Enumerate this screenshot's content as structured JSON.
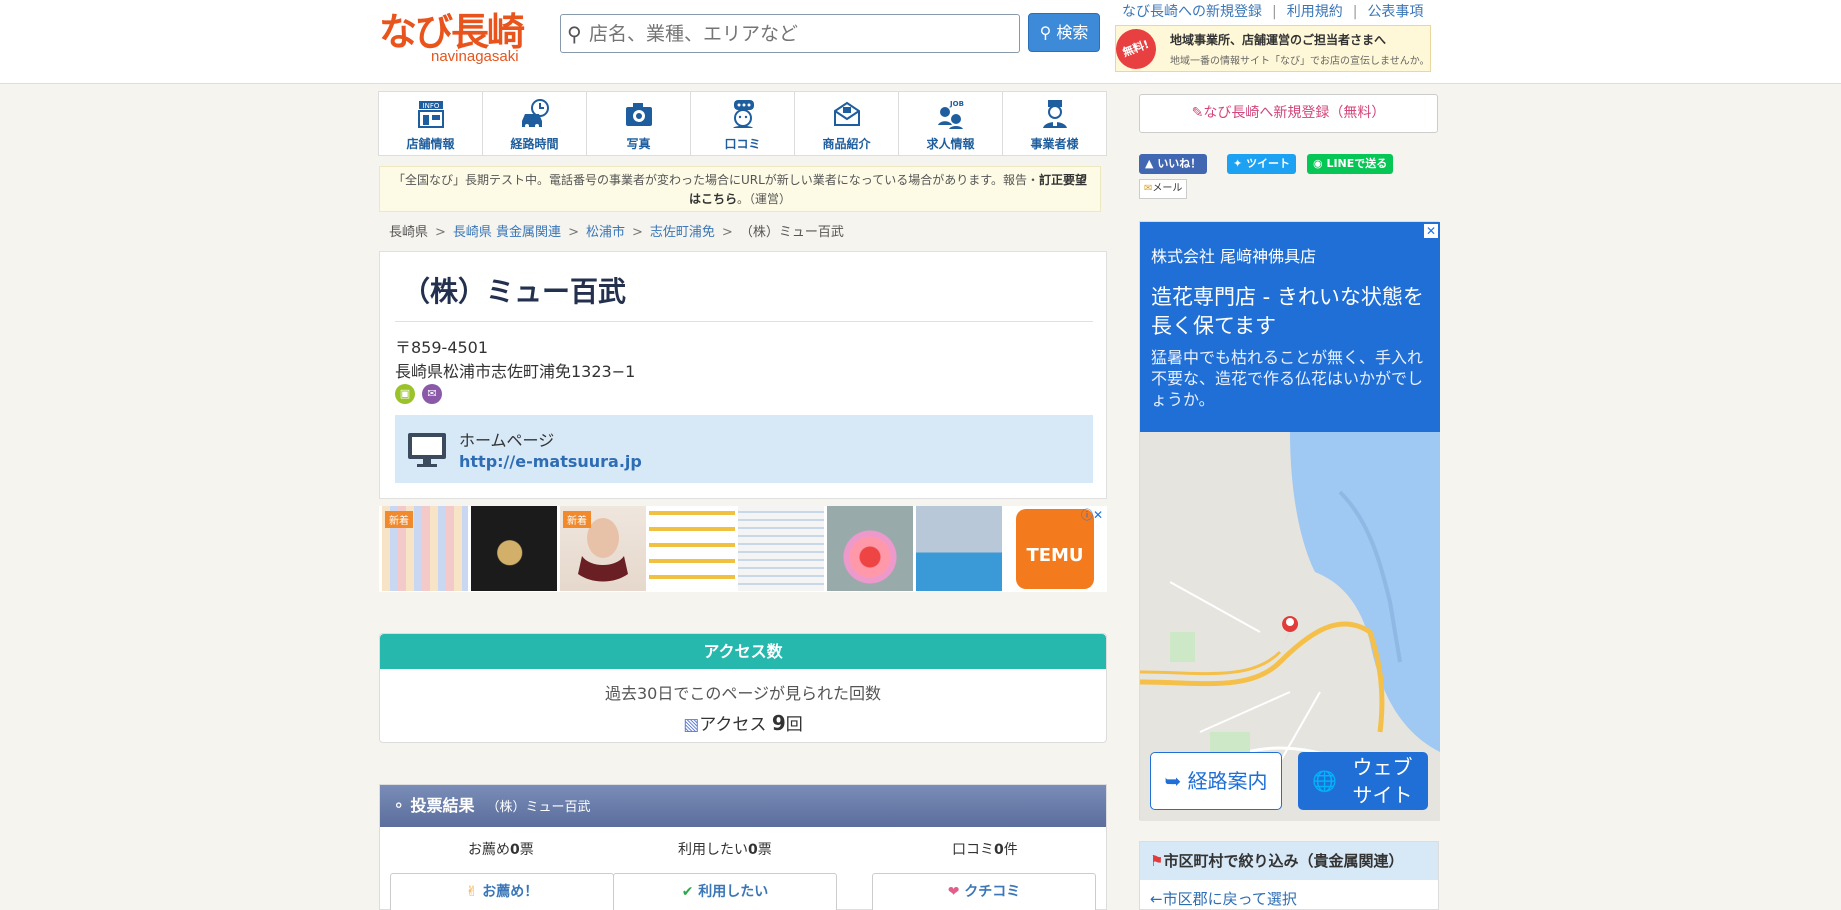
{
  "header": {
    "logo_main": "なび長崎",
    "logo_sub": "navinagasaki",
    "search_placeholder": "店名、業種、エリアなど",
    "search_button": "検索",
    "top_links": [
      "なび長崎への新規登録",
      "利用規約",
      "公表事項"
    ],
    "promo_badge": "無料!",
    "promo_title": "地域事業所、店舗運営のご担当者さまへ",
    "promo_sub": "地域一番の情報サイト「なび」でお店の宣伝しませんか。"
  },
  "menu": [
    {
      "label": "店舗情報",
      "icon": "info-icon"
    },
    {
      "label": "経路時間",
      "icon": "car-clock-icon"
    },
    {
      "label": "写真",
      "icon": "camera-icon"
    },
    {
      "label": "口コミ",
      "icon": "chat-person-icon"
    },
    {
      "label": "商品紹介",
      "icon": "product-icon"
    },
    {
      "label": "求人情報",
      "icon": "job-icon"
    },
    {
      "label": "事業者様",
      "icon": "business-owner-icon"
    }
  ],
  "notice": {
    "text": "「全国なび」長期テスト中。電話番号の事業者が変わった場合にURLが新しい業者になっている場合があります。報告・",
    "bold": "訂正要望はこちら",
    "suffix": "。（運営）"
  },
  "breadcrumb": [
    "長崎県",
    "長崎県 貴金属関連",
    "松浦市",
    "志佐町浦免",
    "（株）ミュー百武"
  ],
  "shop": {
    "title": "（株）ミュー百武",
    "postal": "〒859-4501",
    "address": "長崎県松浦市志佐町浦免1323−1",
    "homepage_label": "ホームページ",
    "homepage_url": "http://e-matsuura.jp"
  },
  "ads": {
    "new_label": "新着",
    "temu_label": "TEMU"
  },
  "access": {
    "title": "アクセス数",
    "desc": "過去30日でこのページが見られた回数",
    "label": "アクセス",
    "count": "9",
    "unit": "回"
  },
  "vote": {
    "title": "投票結果",
    "shop_name": "（株）ミュー百武",
    "recommend_label": "お薦め",
    "recommend_count": "0",
    "vote_unit": "票",
    "use_label": "利用したい",
    "use_count": "0",
    "review_label": "口コミ",
    "review_count": "0",
    "review_unit": "件",
    "btn_recommend": "お薦め！",
    "btn_use": "利用したい",
    "btn_review": "クチコミ"
  },
  "sidebar": {
    "register": "なび長崎へ新規登録（無料）",
    "like": "いいね！",
    "tweet": "ツイート",
    "line": "LINEで送る",
    "mail": "メール",
    "ad_company": "株式会社 尾﨑神佛具店",
    "ad_headline": "造花専門店 - きれいな状態を長く保てます",
    "ad_body": "猛暑中でも枯れることが無く、手入れ不要な、造花で作る仏花はいかがでしょうか。",
    "ad_route": "経路案内",
    "ad_website": "ウェブ サイト",
    "filter_title": "市区町村で絞り込み（貴金属関連）",
    "filter_back": "市区郡に戻って選択"
  },
  "colors": {
    "accent_orange": "#e8541c",
    "link_blue": "#3a76b8",
    "teal": "#27b8ad",
    "vote_head": "#6a7dac"
  }
}
